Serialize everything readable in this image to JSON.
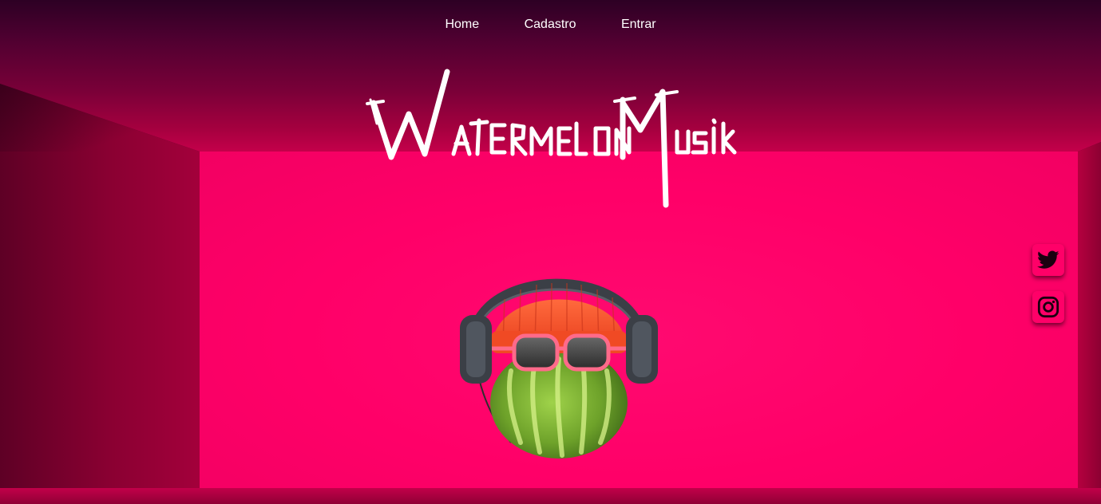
{
  "nav": {
    "items": [
      {
        "label": "Home"
      },
      {
        "label": "Cadastro"
      },
      {
        "label": "Entrar"
      }
    ]
  },
  "logo": {
    "text": "Watermelon Musik"
  },
  "social": [
    {
      "icon": "twitter-icon"
    },
    {
      "icon": "instagram-icon"
    }
  ],
  "colors": {
    "accent": "#ff0068",
    "wall": "#ff0a70",
    "text": "#ffffff"
  }
}
